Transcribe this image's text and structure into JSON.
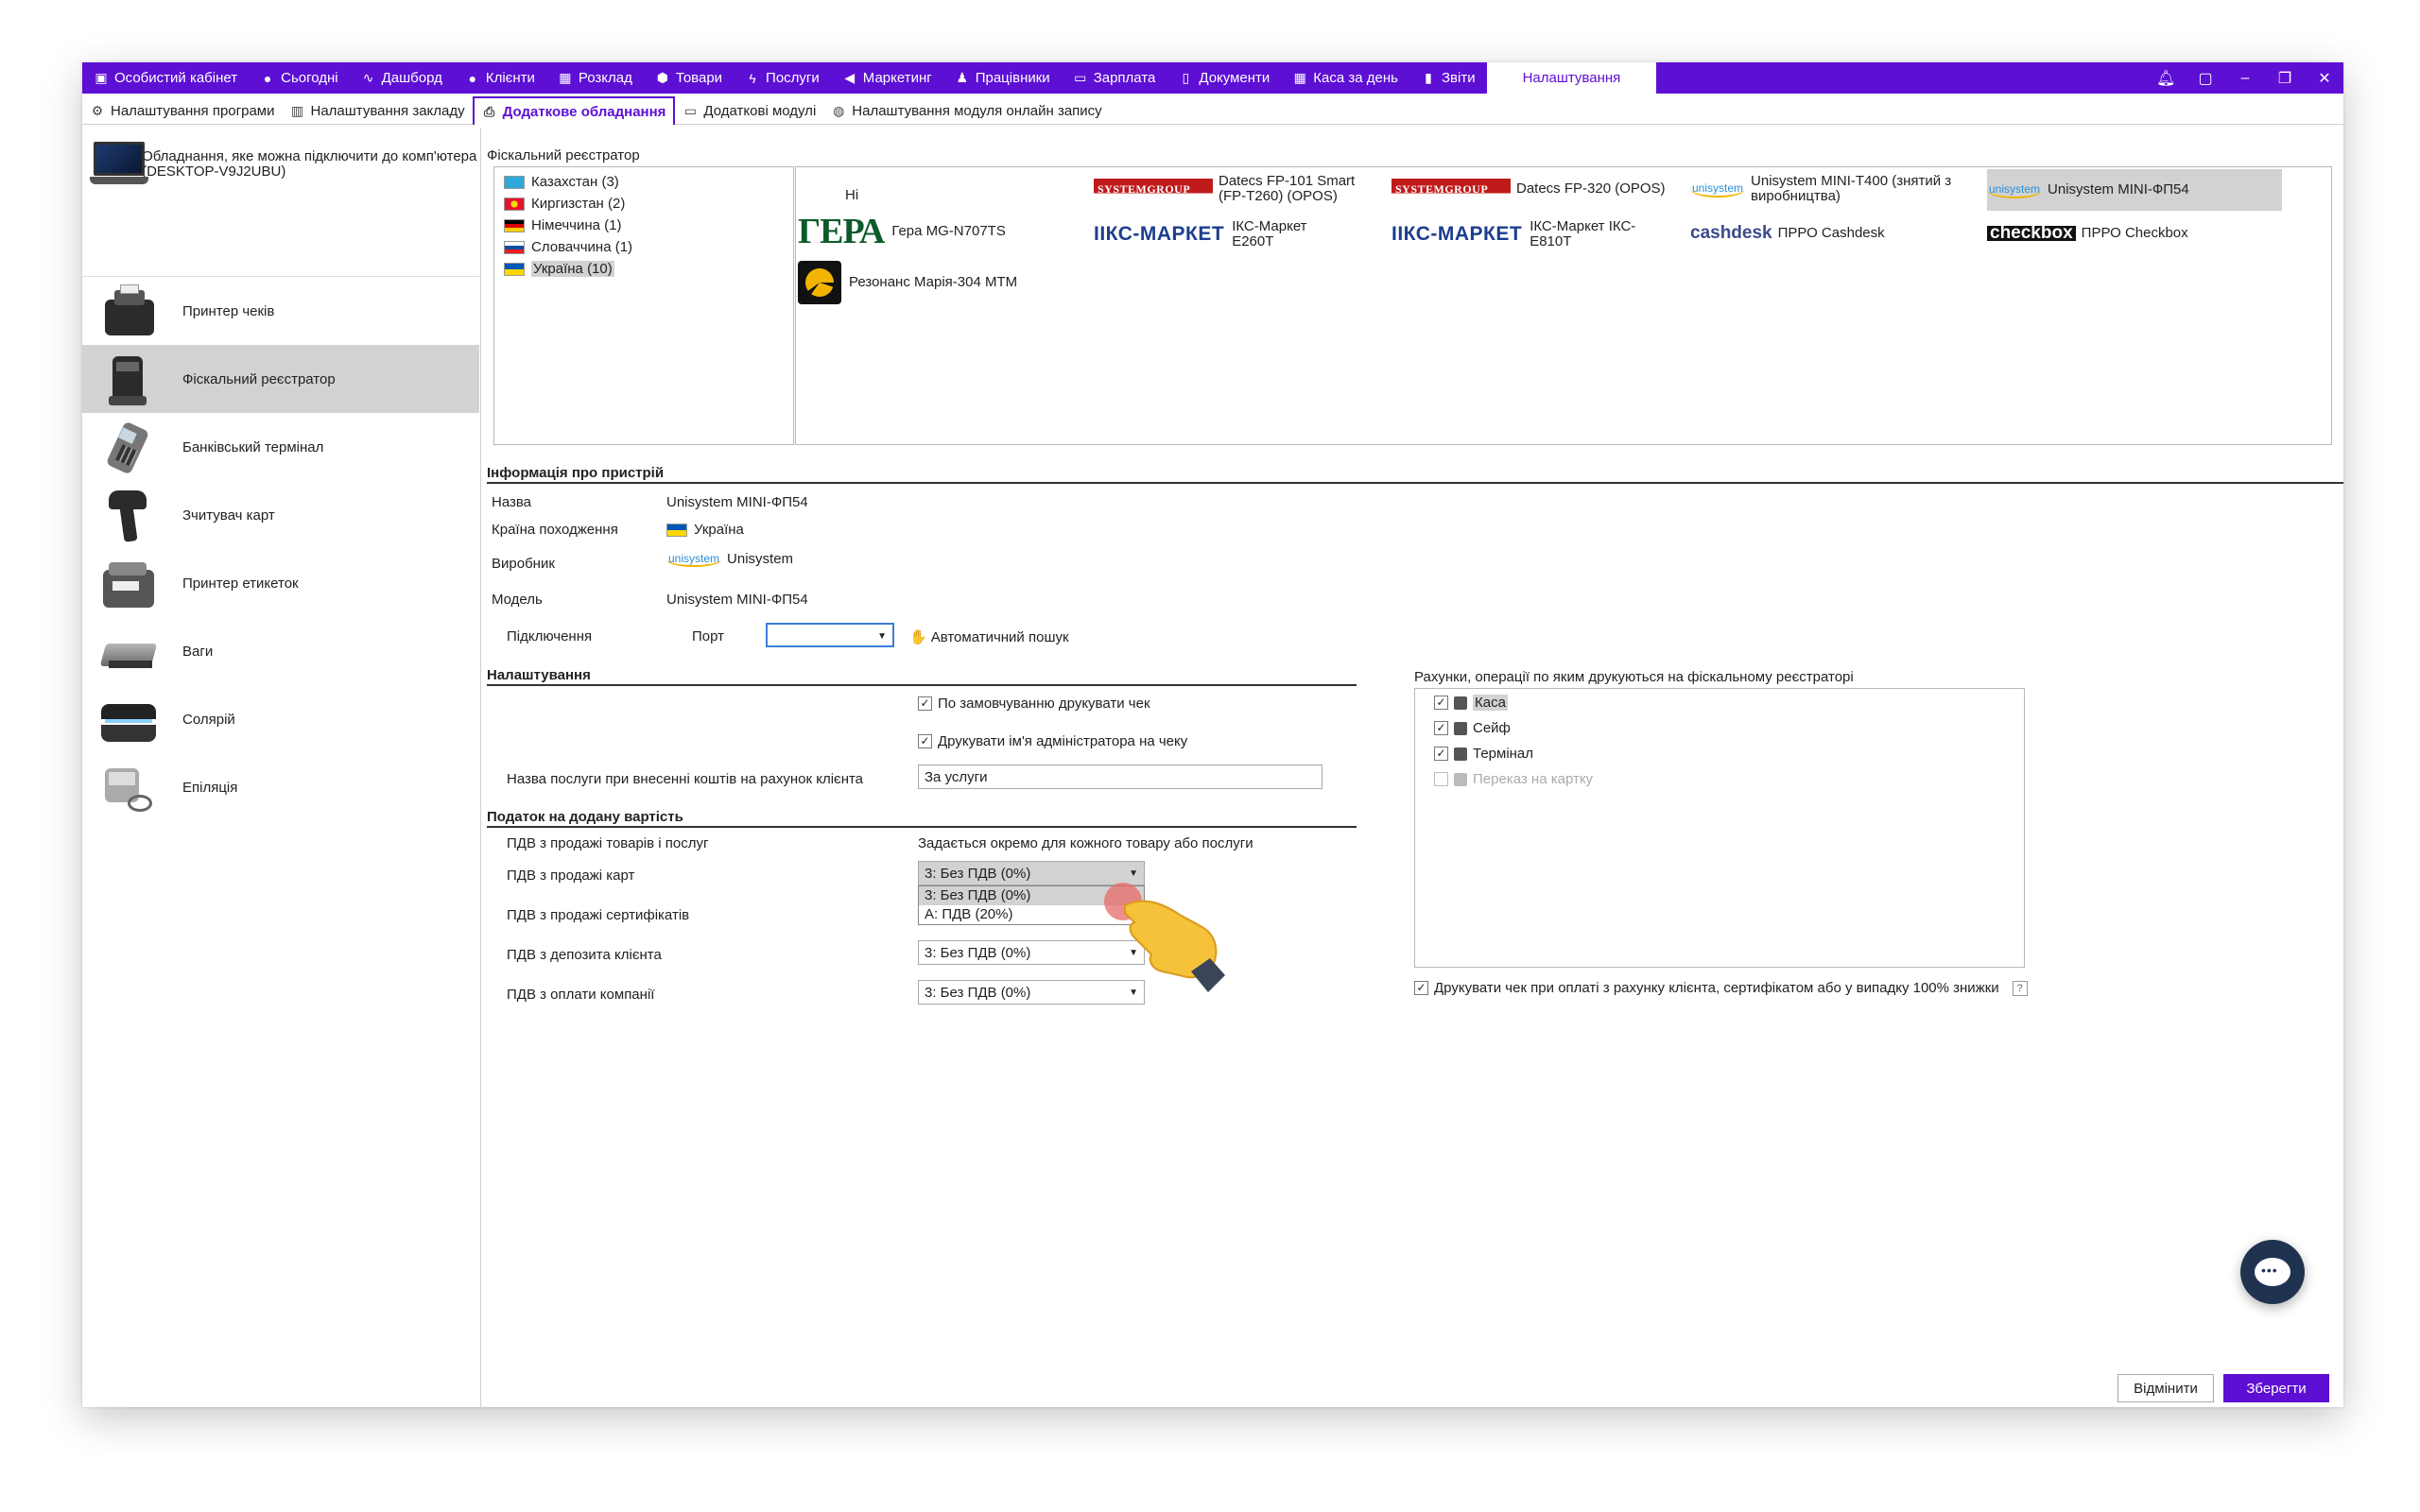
{
  "nav": {
    "items": [
      {
        "label": "Особистий кабінет",
        "icon": "briefcase-icon",
        "glyph": "▣"
      },
      {
        "label": "Сьогодні",
        "icon": "clock-icon",
        "glyph": "●"
      },
      {
        "label": "Дашборд",
        "icon": "pulse-icon",
        "glyph": "∿"
      },
      {
        "label": "Клієнти",
        "icon": "user-circle-icon",
        "glyph": "●"
      },
      {
        "label": "Розклад",
        "icon": "calendar-icon",
        "glyph": "▦"
      },
      {
        "label": "Товари",
        "icon": "box-icon",
        "glyph": "⬢"
      },
      {
        "label": "Послуги",
        "icon": "lightning-icon",
        "glyph": "ϟ"
      },
      {
        "label": "Маркетинг",
        "icon": "megaphone-icon",
        "glyph": "◀"
      },
      {
        "label": "Працівники",
        "icon": "person-icon",
        "glyph": "♟"
      },
      {
        "label": "Зарплата",
        "icon": "money-icon",
        "glyph": "▭"
      },
      {
        "label": "Документи",
        "icon": "document-icon",
        "glyph": "▯"
      },
      {
        "label": "Каса за день",
        "icon": "calculator-icon",
        "glyph": "▦"
      },
      {
        "label": "Звіти",
        "icon": "bar-chart-icon",
        "glyph": "▮"
      }
    ],
    "active": "Налаштування"
  },
  "subnav": {
    "items": [
      {
        "label": "Налаштування програми",
        "icon": "gear-icon",
        "glyph": "⚙"
      },
      {
        "label": "Налаштування закладу",
        "icon": "building-icon",
        "glyph": "▥"
      },
      {
        "label": "Додаткове обладнання",
        "icon": "printer-icon",
        "glyph": "⎙"
      },
      {
        "label": "Додаткові модулі",
        "icon": "module-icon",
        "glyph": "▭"
      },
      {
        "label": "Налаштування модуля онлайн запису",
        "icon": "globe-icon",
        "glyph": "◍"
      }
    ]
  },
  "left": {
    "computer_label": "Обладнання, яке можна підключити до комп'ютера (DESKTOP-V9J2UBU)",
    "devices": [
      {
        "label": "Принтер чеків"
      },
      {
        "label": "Фіскальний реєстратор"
      },
      {
        "label": "Банківський термінал"
      },
      {
        "label": "Зчитувач карт"
      },
      {
        "label": "Принтер етикеток"
      },
      {
        "label": "Ваги"
      },
      {
        "label": "Солярій"
      },
      {
        "label": "Епіляція"
      }
    ]
  },
  "fiscal": {
    "title": "Фіскальний реєстратор",
    "countries": [
      {
        "label": "Казахстан (3)",
        "colors": [
          "#2ea8d8",
          "#f2c500"
        ]
      },
      {
        "label": "Киргизстан (2)",
        "colors": [
          "#e8112d",
          "#ffd700"
        ]
      },
      {
        "label": "Німеччина (1)",
        "colors": [
          "#000000",
          "#dd0000",
          "#ffce00"
        ]
      },
      {
        "label": "Словаччина (1)",
        "colors": [
          "#ffffff",
          "#0b4ea2",
          "#ee1c25"
        ]
      },
      {
        "label": "Україна (10)",
        "colors": [
          "#0057b7",
          "#ffd700"
        ]
      }
    ],
    "models": {
      "none": "Ні",
      "gera_logo": "ГЕРА",
      "gera": "Гера MG-N707TS",
      "rezonans": "Резонанс Марія-304 МТМ",
      "sg_logo": "SYSTEMGROUP",
      "datecs1": "Datecs FP-101 Smart (FP-T260) (OPOS)",
      "iks_logo": "ІІКС-МАРКЕТ",
      "iks1": "ІКС-Маркет Е260Т",
      "datecs2": "Datecs FP-320 (OPOS)",
      "iks2": "ІКС-Маркет ІКС-Е810Т",
      "uni_logo": "unisystem",
      "uni1": "Unisystem MINI-T400 (знятий з виробництва)",
      "cash_logo": "cashdesk",
      "cashdesk": "ПРРО Cashdesk",
      "uni2": "Unisystem MINI-ФП54",
      "checkbox_logo": "checkbox",
      "checkbox": "ПРРО Checkbox"
    }
  },
  "info": {
    "title": "Інформація про пристрій",
    "name_label": "Назва",
    "name_value": "Unisystem MINI-ФП54",
    "country_label": "Країна походження",
    "country_value": "Україна",
    "maker_label": "Виробник",
    "maker_logo": "unisystem",
    "maker_value": "Unisystem",
    "model_label": "Модель",
    "model_value": "Unisystem MINI-ФП54",
    "conn_label": "Підключення",
    "port_label": "Порт",
    "port_value": "",
    "autosearch": "Автоматичний пошук"
  },
  "settings": {
    "title": "Налаштування",
    "print_default": "По замовчуванню друкувати чек",
    "print_admin": "Друкувати ім'я адміністратора на чеку",
    "service_label": "Назва послуги при внесенні коштів на рахунок клієнта",
    "service_value": "За услуги"
  },
  "vat": {
    "title": "Податок на додану вартість",
    "goods_label": "ПДВ з продажі товарів і послуг",
    "goods_value": "Задається окремо для кожного товару або послуги",
    "cards_label": "ПДВ з продажі карт",
    "cards_value": "3: Без ПДВ (0%)",
    "options": [
      "3: Без ПДВ (0%)",
      "А: ПДВ (20%)"
    ],
    "certs_label": "ПДВ з продажі сертифікатів",
    "deposit_label": "ПДВ з депозита клієнта",
    "deposit_value": "3: Без ПДВ (0%)",
    "company_label": "ПДВ з оплати компанії",
    "company_value": "3: Без ПДВ (0%)"
  },
  "accounts": {
    "title": "Рахунки, операції по яким друкуються на фіскальному реєстраторі",
    "items": [
      {
        "label": "Каса",
        "checked": "✓"
      },
      {
        "label": "Сейф",
        "checked": "✓"
      },
      {
        "label": "Термінал",
        "checked": "✓"
      },
      {
        "label": "Переказ на картку",
        "checked": ""
      }
    ],
    "print_note": "Друкувати чек при оплаті з рахунку клієнта, сертифікатом або у випадку 100% знижки",
    "help": "?"
  },
  "buttons": {
    "cancel": "Відмінити",
    "save": "Зберегти"
  },
  "colors": {
    "accent": "#5d0fd4",
    "selection": "#d2d2d2"
  }
}
